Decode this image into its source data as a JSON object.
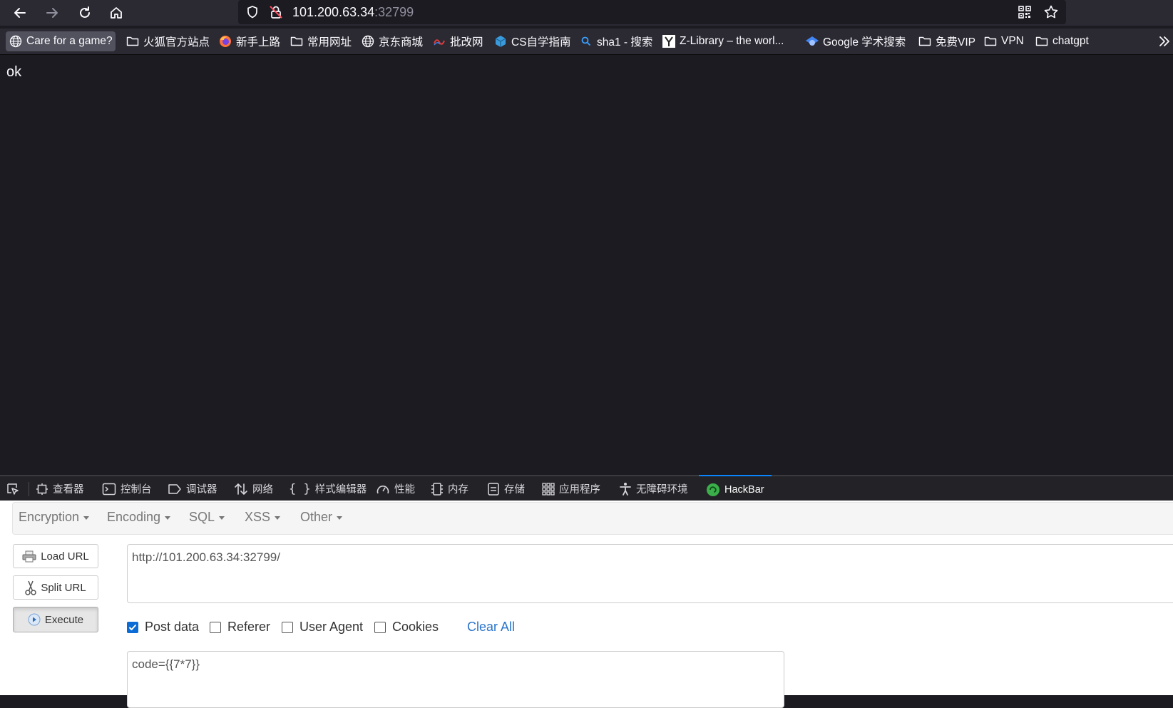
{
  "browser": {
    "url_host": "101.200.63.34",
    "url_port": ":32799"
  },
  "bookmarks": [
    {
      "label": "Care for a game?",
      "icon": "globe-icon"
    },
    {
      "label": "火狐官方站点",
      "icon": "folder-icon"
    },
    {
      "label": "新手上路",
      "icon": "firefox-icon"
    },
    {
      "label": "常用网址",
      "icon": "folder-icon"
    },
    {
      "label": "京东商城",
      "icon": "globe-icon"
    },
    {
      "label": "批改网",
      "icon": "pigai-icon"
    },
    {
      "label": "CS自学指南",
      "icon": "cube-icon"
    },
    {
      "label": "sha1 - 搜索",
      "icon": "search-icon"
    },
    {
      "label": "Z-Library – the worl...",
      "icon": "zlib-icon"
    },
    {
      "label": "Google 学术搜索",
      "icon": "scholar-icon"
    },
    {
      "label": "免费VIP",
      "icon": "folder-icon"
    },
    {
      "label": "VPN",
      "icon": "folder-icon"
    },
    {
      "label": "chatgpt",
      "icon": "folder-icon"
    }
  ],
  "page": {
    "body_text": "ok"
  },
  "devtools": {
    "tabs": [
      {
        "label": "查看器",
        "icon": "inspector-icon"
      },
      {
        "label": "控制台",
        "icon": "console-icon"
      },
      {
        "label": "调试器",
        "icon": "debugger-icon"
      },
      {
        "label": "网络",
        "icon": "network-icon"
      },
      {
        "label": "样式编辑器",
        "icon": "braces-icon"
      },
      {
        "label": "性能",
        "icon": "gauge-icon"
      },
      {
        "label": "内存",
        "icon": "memory-icon"
      },
      {
        "label": "存储",
        "icon": "storage-icon"
      },
      {
        "label": "应用程序",
        "icon": "grid-icon"
      },
      {
        "label": "无障碍环境",
        "icon": "accessibility-icon"
      },
      {
        "label": "HackBar",
        "icon": "hackbar-icon",
        "active": true
      }
    ]
  },
  "hackbar": {
    "menu": [
      "Encryption",
      "Encoding",
      "SQL",
      "XSS",
      "Other"
    ],
    "buttons": {
      "load": "Load URL",
      "split": "Split URL",
      "execute": "Execute"
    },
    "url_value": "http://101.200.63.34:32799/",
    "options": [
      {
        "label": "Post data",
        "checked": true
      },
      {
        "label": "Referer",
        "checked": false
      },
      {
        "label": "User Agent",
        "checked": false
      },
      {
        "label": "Cookies",
        "checked": false
      }
    ],
    "clear_all": "Clear All",
    "post_value": "code={{7*7}}"
  },
  "colors": {
    "accent": "#0a84ff",
    "checkbox_checked": "#0b6cd5",
    "link": "#2a74c9",
    "page_bg": "#1c1b22"
  }
}
